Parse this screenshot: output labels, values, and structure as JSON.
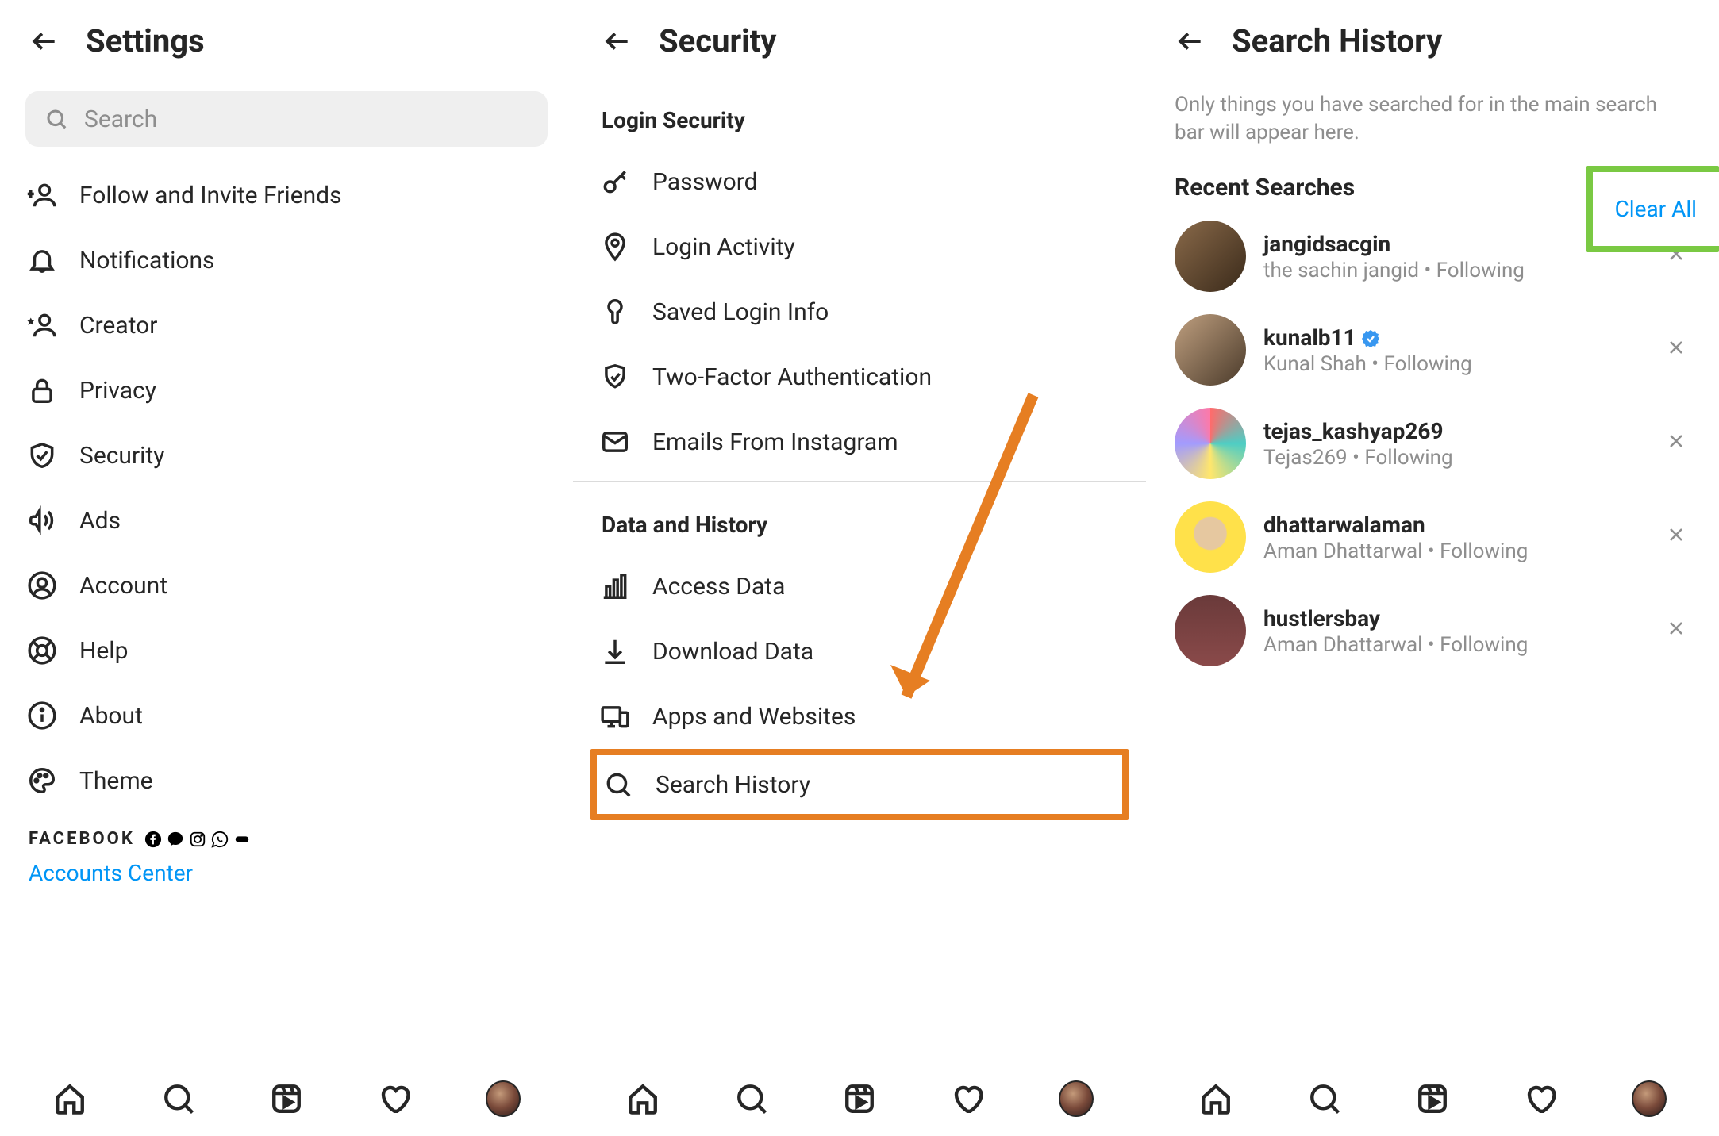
{
  "colors": {
    "link": "#0095f6",
    "highlight_orange": "#e67e22",
    "highlight_green": "#7ac943"
  },
  "panel1": {
    "title": "Settings",
    "search_placeholder": "Search",
    "items": [
      "Follow and Invite Friends",
      "Notifications",
      "Creator",
      "Privacy",
      "Security",
      "Ads",
      "Account",
      "Help",
      "About",
      "Theme"
    ],
    "footer_brand": "FACEBOOK",
    "accounts_center": "Accounts Center"
  },
  "panel2": {
    "title": "Security",
    "sections": {
      "login": {
        "header": "Login Security",
        "items": [
          "Password",
          "Login Activity",
          "Saved Login Info",
          "Two-Factor Authentication",
          "Emails From Instagram"
        ]
      },
      "data": {
        "header": "Data and History",
        "items": [
          "Access Data",
          "Download Data",
          "Apps and Websites",
          "Search History"
        ]
      }
    }
  },
  "panel3": {
    "title": "Search History",
    "info": "Only things you have searched for in the main search bar will appear here.",
    "recent_header": "Recent Searches",
    "clear_all": "Clear All",
    "dot": " • ",
    "following": "Following",
    "items": [
      {
        "username": "jangidsacgin",
        "name": "the sachin jangid",
        "verified": false
      },
      {
        "username": "kunalb11",
        "name": "Kunal Shah",
        "verified": true
      },
      {
        "username": "tejas_kashyap269",
        "name": "Tejas269",
        "verified": false
      },
      {
        "username": "dhattarwalaman",
        "name": "Aman Dhattarwal",
        "verified": false
      },
      {
        "username": "hustlersbay",
        "name": "Aman Dhattarwal",
        "verified": false
      }
    ]
  }
}
